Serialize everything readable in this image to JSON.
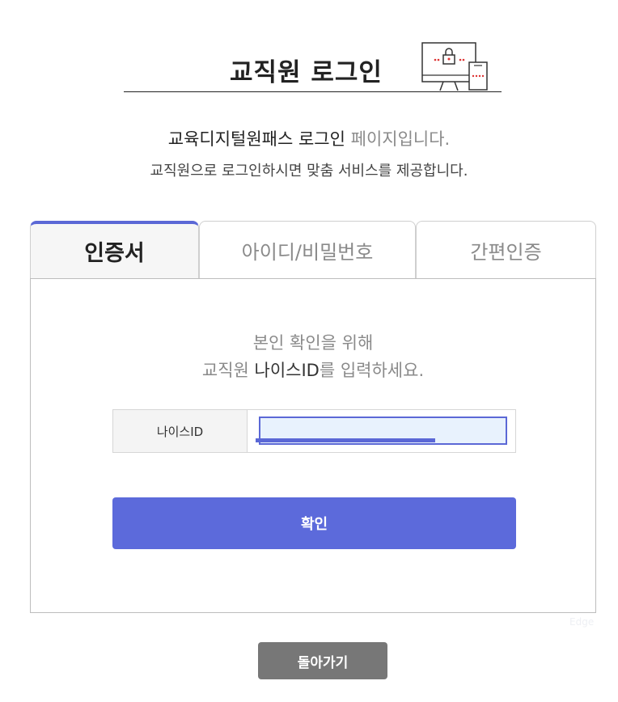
{
  "header": {
    "title": "교직원 로그인",
    "device_icon": "computer-lock-icon"
  },
  "intro": {
    "line1_strong": "교육디지털원패스 로그인",
    "line1_muted": " 페이지입니다.",
    "line2": "교직원으로 로그인하시면 맞춤 서비스를 제공합니다."
  },
  "tabs": [
    {
      "label": "인증서",
      "active": true
    },
    {
      "label": "아이디/비밀번호",
      "active": false
    },
    {
      "label": "간편인증",
      "active": false
    }
  ],
  "panel": {
    "guide_line1": "본인 확인을 위해",
    "guide_prefix": "교직원 ",
    "guide_strong": "나이스ID",
    "guide_suffix": "를 입력하세요.",
    "field_label": "나이스ID",
    "field_value": "",
    "confirm_label": "확인"
  },
  "watermark": "Edge",
  "back_label": "돌아가기",
  "colors": {
    "accent": "#5c6adb",
    "back_button": "#777777",
    "muted_text": "#8a8a8a"
  }
}
